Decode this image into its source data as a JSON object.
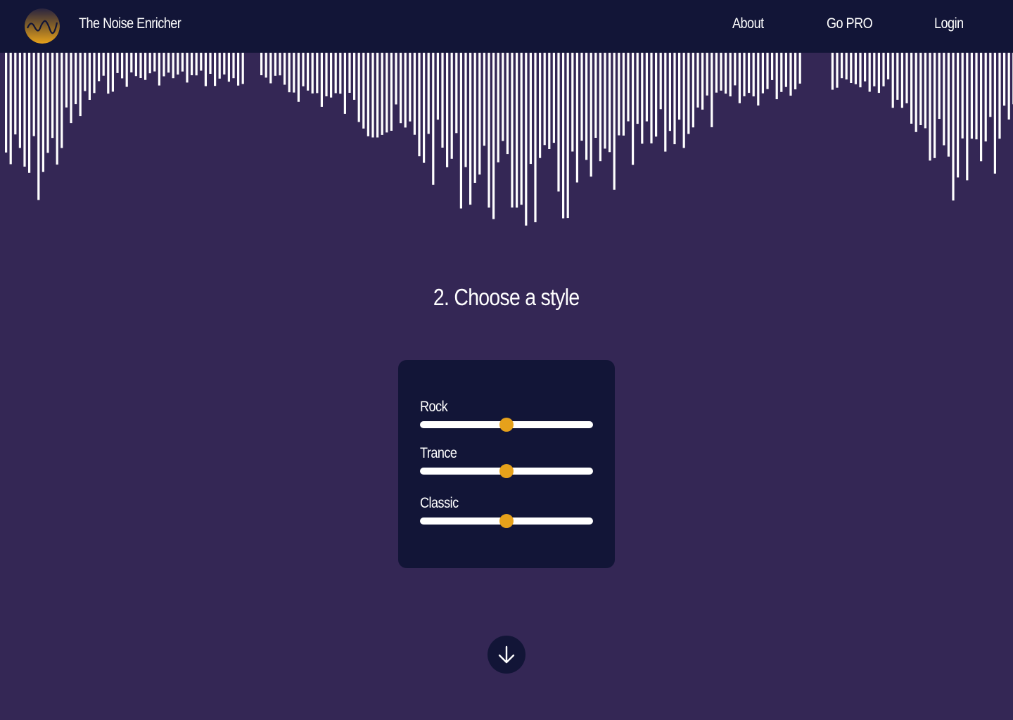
{
  "header": {
    "logo": {
      "icon": "waveform-logo-icon",
      "color_top": "#121537",
      "color_bottom": "#e6a11b"
    },
    "brand": "The Noise Enricher",
    "nav": [
      {
        "label": "About"
      },
      {
        "label": "Go PRO"
      },
      {
        "label": "Login"
      }
    ]
  },
  "main": {
    "step_title": "2.  Choose a style",
    "styles": [
      {
        "label": "Rock",
        "value": 0.5
      },
      {
        "label": "Trance",
        "value": 0.5
      },
      {
        "label": "Classic",
        "value": 0.5
      }
    ],
    "scroll_button": {
      "icon": "arrow-down-icon"
    }
  },
  "colors": {
    "background": "#342755",
    "navbar": "#121537",
    "panel": "#121537",
    "accent": "#e6a11b",
    "waveform": "#ffffff"
  }
}
